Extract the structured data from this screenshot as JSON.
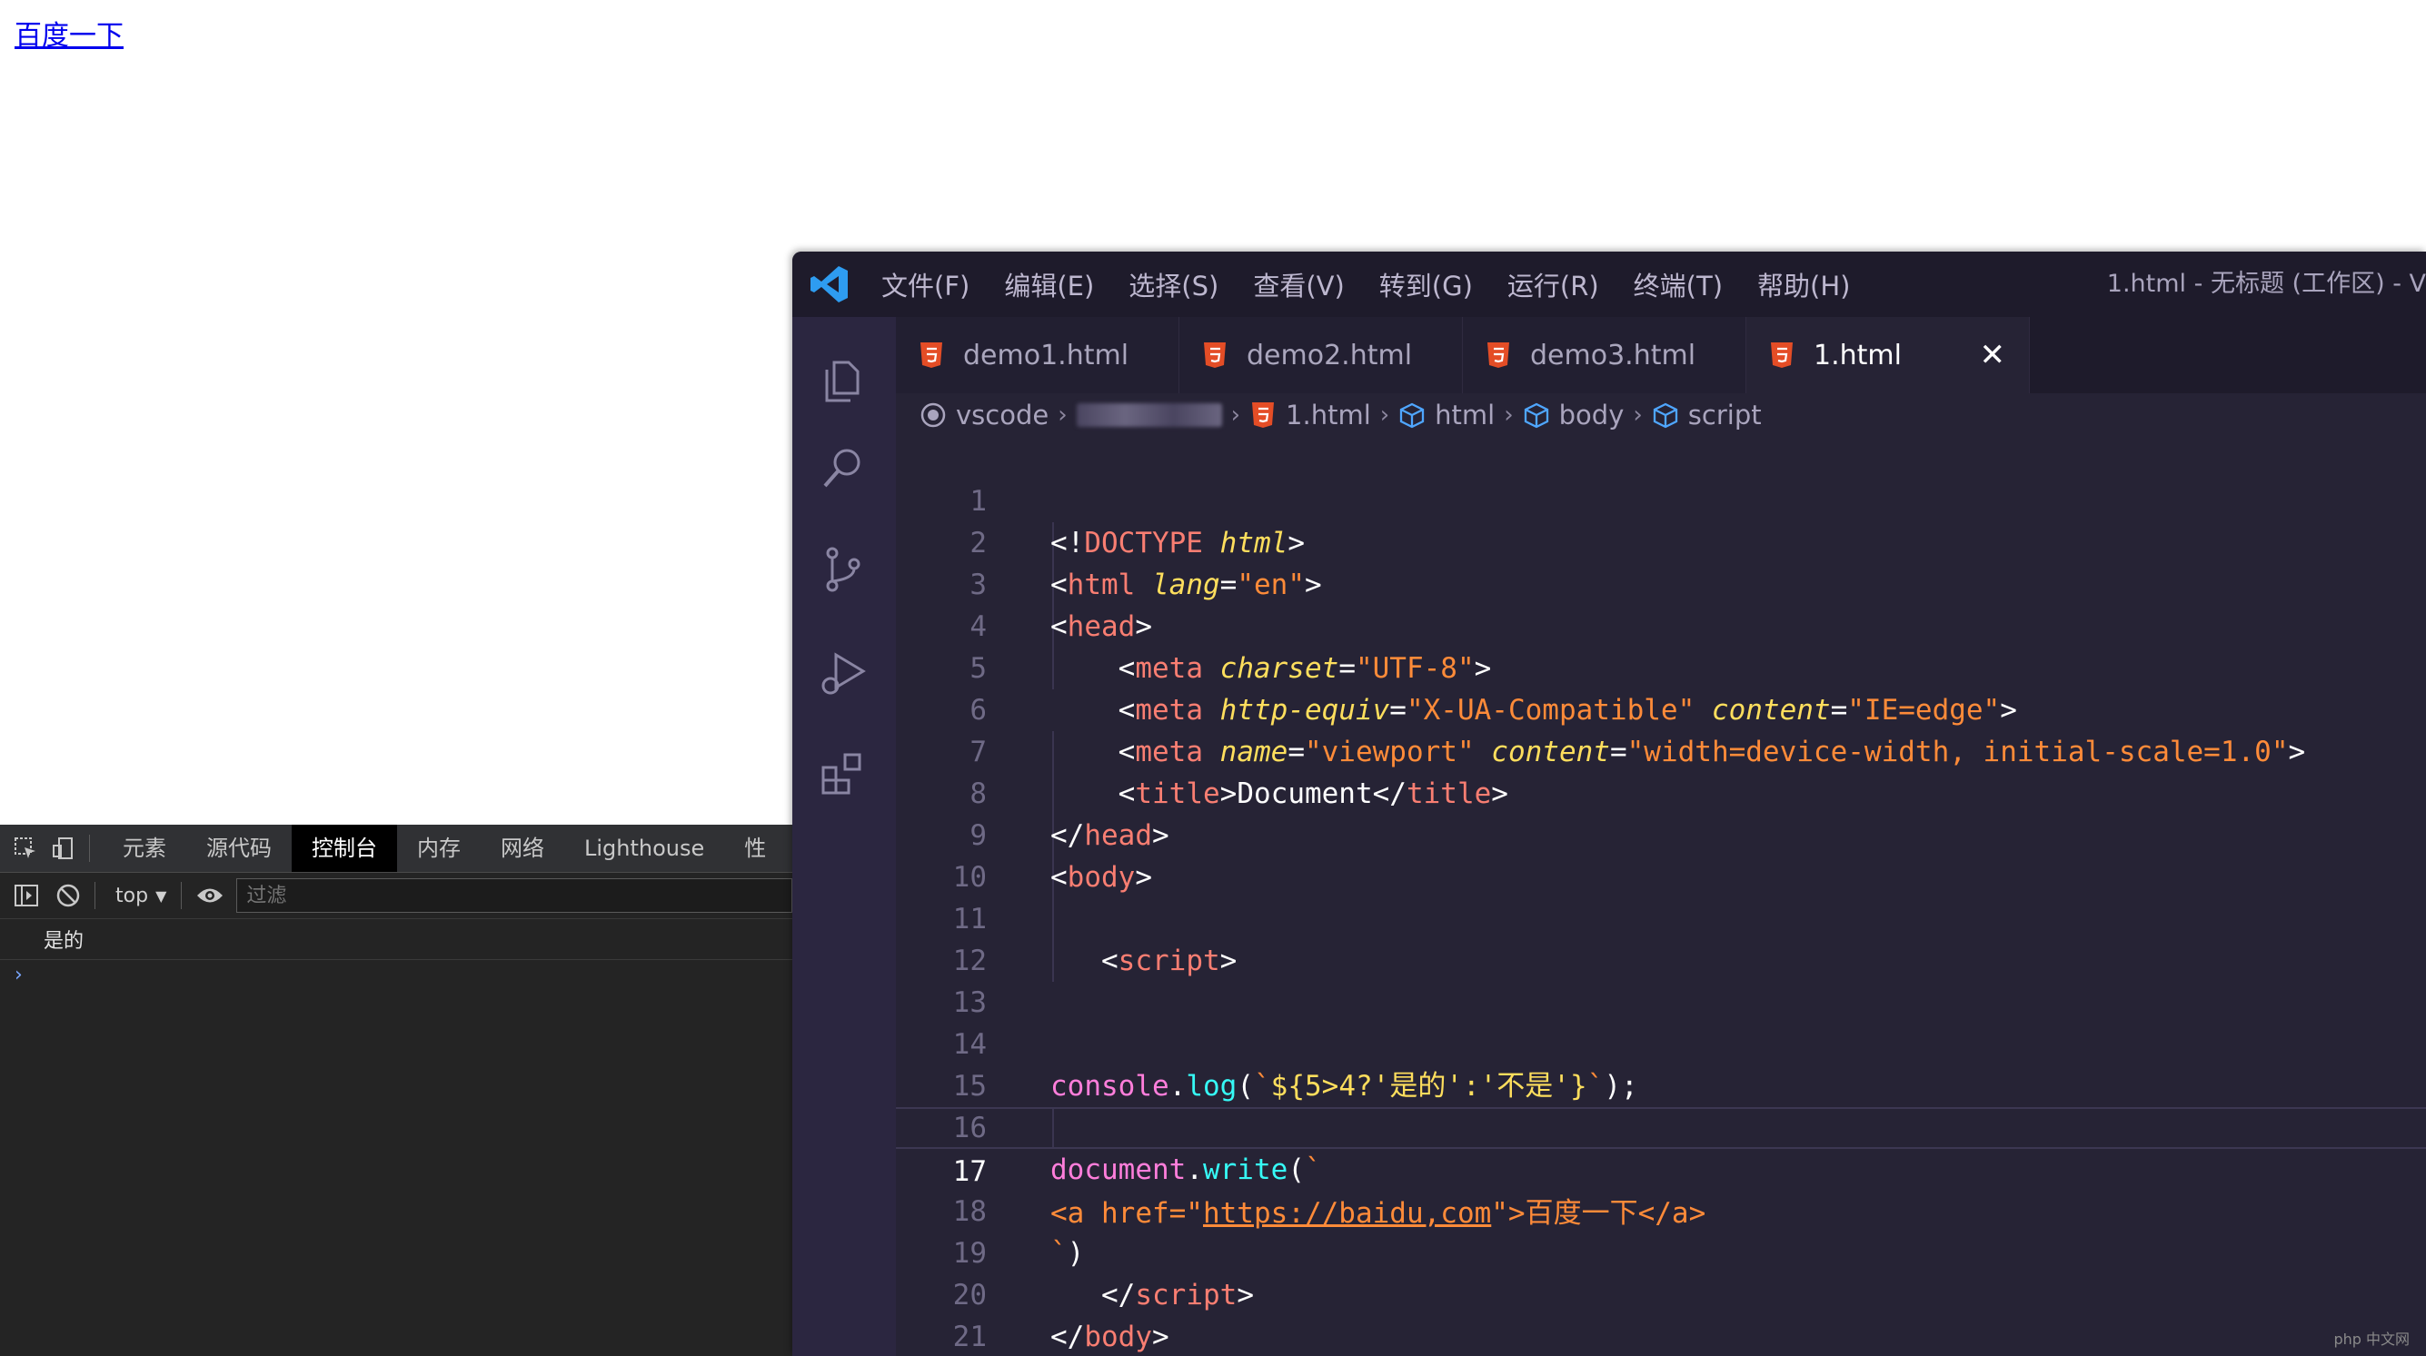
{
  "rendered_page": {
    "link_text": "百度一下"
  },
  "devtools": {
    "tabs": [
      "元素",
      "源代码",
      "控制台",
      "内存",
      "网络",
      "Lighthouse",
      "性"
    ],
    "active_tab": "控制台",
    "context": "top",
    "filter_placeholder": "过滤",
    "console_output": "是的",
    "prompt_symbol": "›"
  },
  "vscode": {
    "menu": [
      "文件(F)",
      "编辑(E)",
      "选择(S)",
      "查看(V)",
      "转到(G)",
      "运行(R)",
      "终端(T)",
      "帮助(H)"
    ],
    "window_title": "1.html - 无标题 (工作区) - V",
    "tabs": [
      "demo1.html",
      "demo2.html",
      "demo3.html",
      "1.html"
    ],
    "active_tab": "1.html",
    "close_symbol": "✕",
    "breadcrumb": {
      "root": "vscode",
      "file": "1.html",
      "nodes": [
        "html",
        "body",
        "script"
      ]
    },
    "line_numbers": [
      "1",
      "2",
      "3",
      "4",
      "5",
      "6",
      "7",
      "8",
      "9",
      "10",
      "11",
      "12",
      "13",
      "14",
      "15",
      "16",
      "17",
      "18",
      "19",
      "20",
      "21"
    ],
    "current_line": 17,
    "code_text": {
      "doctype_open": "<!",
      "doctype_kw": "DOCTYPE",
      "doctype_html": "html",
      "lang_attr": "lang",
      "lang_val": "\"en\"",
      "charset_attr": "charset",
      "charset_val": "\"UTF-8\"",
      "http_equiv_attr": "http-equiv",
      "http_equiv_val": "\"X-UA-Compatible\"",
      "content_attr": "content",
      "ie_val": "\"IE=edge\"",
      "name_attr": "name",
      "viewport_val": "\"viewport\"",
      "viewport_content": "\"width=device-width, initial-scale=1.0\"",
      "title_text": "Document",
      "console_ident": "console",
      "log_fn": "log",
      "tpl_expr": "${5>4?'是的':'不是'}",
      "document_ident": "document",
      "write_fn": "write",
      "a_open": "<a href=\"",
      "a_href": "https://baidu,com",
      "a_rest": "\">百度一下</a>",
      "tag_html": "html",
      "tag_head": "head",
      "tag_meta": "meta",
      "tag_title": "title",
      "tag_body": "body",
      "tag_script": "script"
    }
  },
  "watermark": "php 中文网",
  "colors": {
    "vscode_bg": "#262335",
    "devtools_bg": "#242424",
    "link": "#0000ee"
  }
}
